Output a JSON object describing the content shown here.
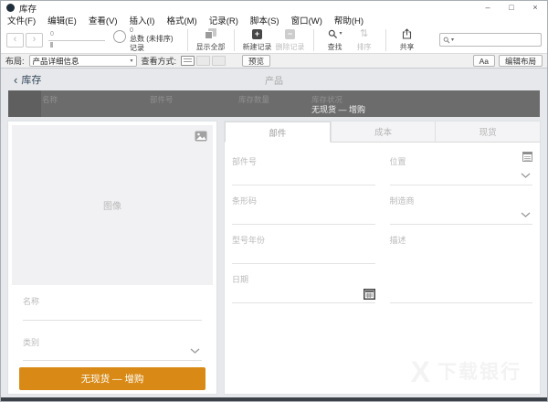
{
  "window": {
    "title": "库存"
  },
  "icons": {
    "minimize": "–",
    "maximize": "□",
    "close": "×",
    "nav_back": "‹",
    "nav_forward": "›",
    "plus": "+",
    "minus": "−",
    "caret_down": "▾",
    "sort": "⇅",
    "back_chevron": "‹"
  },
  "menu": {
    "items": [
      "文件(F)",
      "编辑(E)",
      "查看(V)",
      "插入(I)",
      "格式(M)",
      "记录(R)",
      "脚本(S)",
      "窗口(W)",
      "帮助(H)"
    ]
  },
  "toolbar": {
    "slider_value": "0",
    "count_value": "0",
    "total_label": "总数 (未排序)",
    "records_label": "记录",
    "buttons": {
      "show_all": "显示全部",
      "new_record": "新建记录",
      "delete_record": "删除记录",
      "find": "查找",
      "sort": "排序",
      "share": "共享"
    },
    "search": {
      "value": "",
      "placeholder": ""
    }
  },
  "layout_bar": {
    "layout_label": "布局:",
    "layout_value": "产品详细信息",
    "view_mode_label": "查看方式:",
    "preview_label": "预览",
    "format_button_label": "Aa",
    "edit_layout_label": "编辑布局"
  },
  "content": {
    "back_label": "库存",
    "page_title": "产品",
    "list_header": {
      "columns": [
        "名称",
        "部件号",
        "库存数量",
        "库存状况"
      ],
      "status_value": "无现货 — 增购"
    },
    "left_panel": {
      "image_label": "图像",
      "name_label": "名称",
      "category_label": "类别",
      "stock_button_label": "无现货 — 增购"
    },
    "right_panel": {
      "tabs": [
        "部件",
        "成本",
        "现货"
      ],
      "fields": {
        "part_number": "部件号",
        "location": "位置",
        "barcode": "条形码",
        "manufacturer": "制造商",
        "model_year": "型号年份",
        "description": "描述",
        "date": "日期"
      }
    },
    "watermark": {
      "mark": "X",
      "text": "下载银行"
    }
  },
  "colors": {
    "accent_orange": "#d98a16",
    "list_bar": "#6c6c6c"
  }
}
